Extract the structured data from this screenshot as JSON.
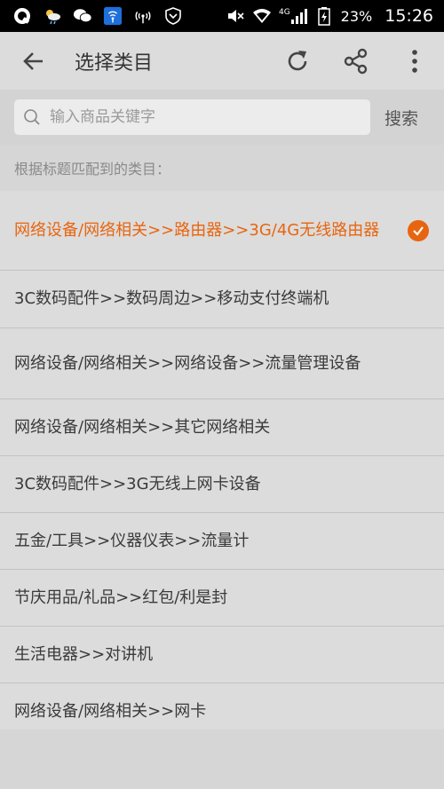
{
  "status_bar": {
    "battery_percent": "23%",
    "time": "15:26",
    "network_label": "4G"
  },
  "toolbar": {
    "title": "选择类目"
  },
  "search": {
    "placeholder": "输入商品关键字",
    "value": "",
    "button_label": "搜索"
  },
  "section_header": "根据标题匹配到的类目：",
  "items": [
    {
      "label": "网络设备/网络相关>>路由器>>3G/4G无线路由器",
      "selected": true
    },
    {
      "label": "3C数码配件>>数码周边>>移动支付终端机",
      "selected": false
    },
    {
      "label": "网络设备/网络相关>>网络设备>>流量管理设备",
      "selected": false
    },
    {
      "label": "网络设备/网络相关>>其它网络相关",
      "selected": false
    },
    {
      "label": "3C数码配件>>3G无线上网卡设备",
      "selected": false
    },
    {
      "label": "五金/工具>>仪器仪表>>流量计",
      "selected": false
    },
    {
      "label": "节庆用品/礼品>>红包/利是封",
      "selected": false
    },
    {
      "label": "生活电器>>对讲机",
      "selected": false
    },
    {
      "label": "网络设备/网络相关>>网卡",
      "selected": false
    }
  ],
  "colors": {
    "accent": "#e8650f",
    "background": "#dcdcdc"
  }
}
